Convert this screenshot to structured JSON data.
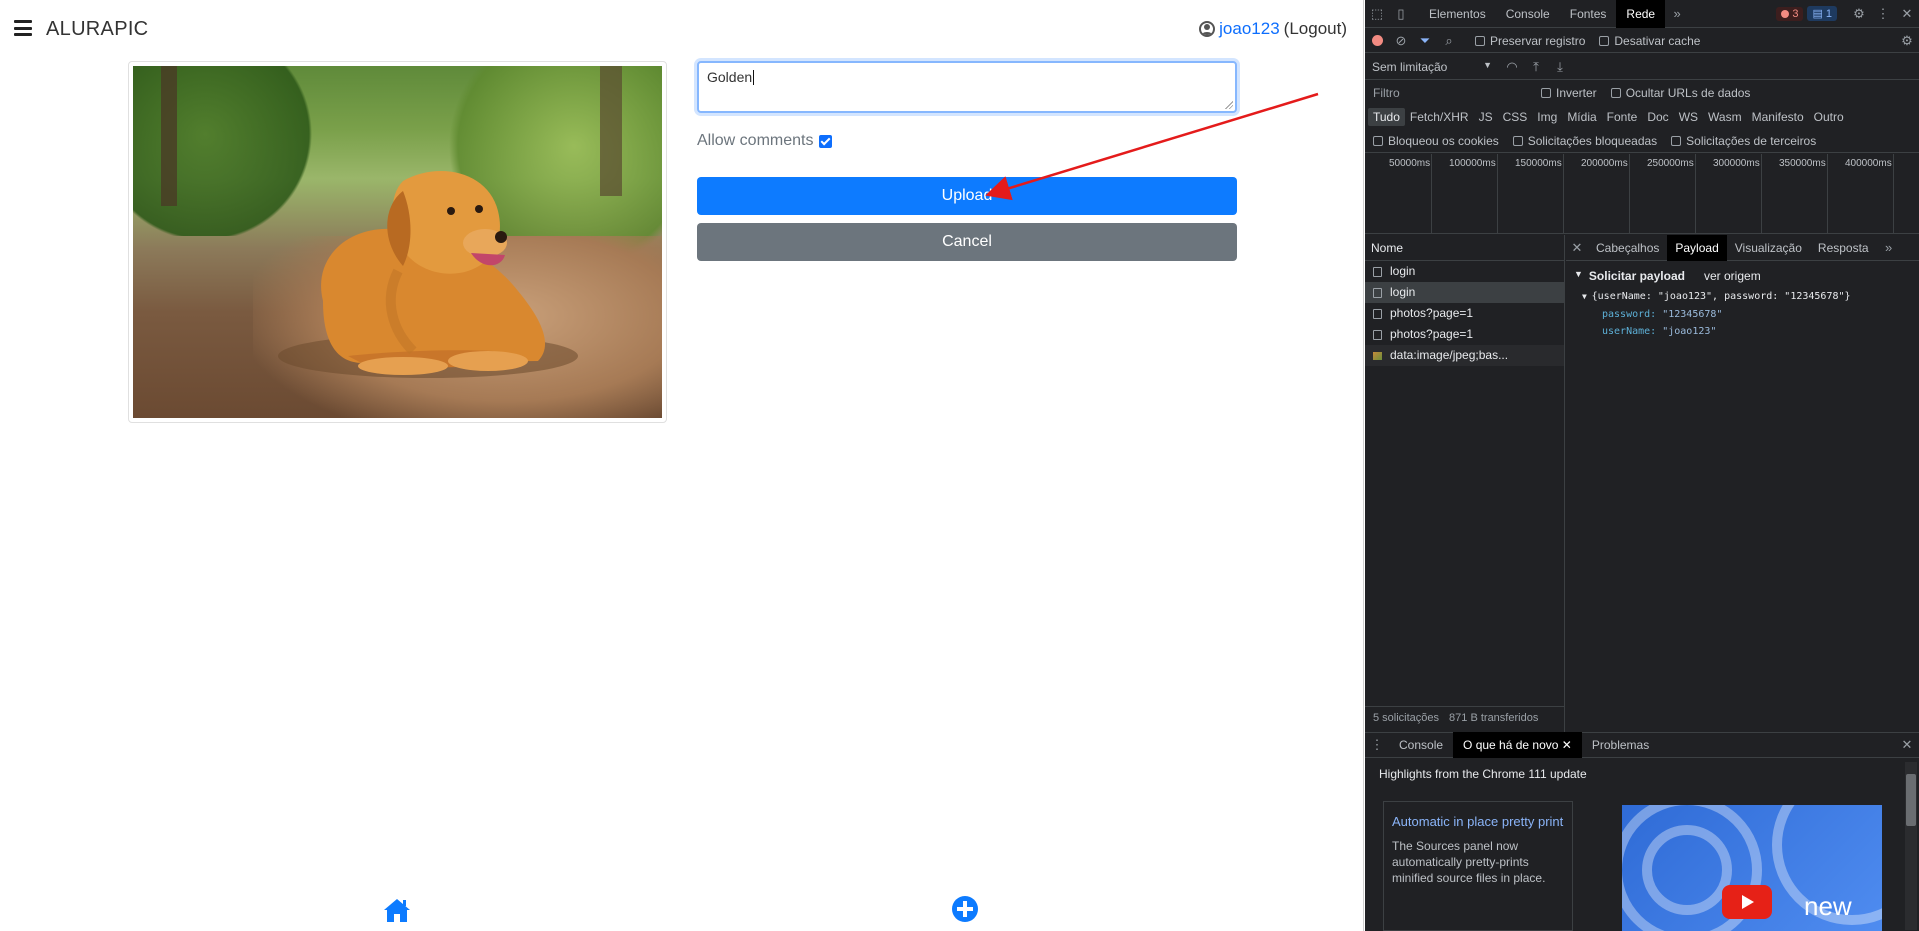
{
  "app": {
    "brand": "ALURAPIC",
    "user_name": "joao123",
    "logout_label": "(Logout)"
  },
  "form": {
    "caption_value": "Golden",
    "allow_comments_label": "Allow comments",
    "allow_comments_checked": true,
    "upload_label": "Upload",
    "cancel_label": "Cancel"
  },
  "colors": {
    "primary": "#0d7bff",
    "secondary": "#6c757d",
    "annotation_arrow": "#e41b1b"
  },
  "devtools": {
    "main_tabs": [
      "Elementos",
      "Console",
      "Fontes",
      "Rede"
    ],
    "active_main_tab": "Rede",
    "error_count": "3",
    "message_count": "1",
    "preserve_log_label": "Preservar registro",
    "disable_cache_label": "Desativar cache",
    "throttling_label": "Sem limitação",
    "filter_placeholder": "Filtro",
    "invert_label": "Inverter",
    "hide_data_urls_label": "Ocultar URLs de dados",
    "type_filters": [
      "Tudo",
      "Fetch/XHR",
      "JS",
      "CSS",
      "Img",
      "Mídia",
      "Fonte",
      "Doc",
      "WS",
      "Wasm",
      "Manifesto",
      "Outro"
    ],
    "blocked_cookies_label": "Bloqueou os cookies",
    "blocked_requests_label": "Solicitações bloqueadas",
    "third_party_label": "Solicitações de terceiros",
    "timeline_ticks": [
      "50000ms",
      "100000ms",
      "150000ms",
      "200000ms",
      "250000ms",
      "300000ms",
      "350000ms",
      "400000ms"
    ],
    "name_header": "Nome",
    "requests": [
      "login",
      "login",
      "photos?page=1",
      "photos?page=1",
      "data:image/jpeg;bas..."
    ],
    "detail_tabs": [
      "Cabeçalhos",
      "Payload",
      "Visualização",
      "Resposta"
    ],
    "active_detail_tab": "Payload",
    "payload_title": "Solicitar payload",
    "view_source_label": "ver origem",
    "payload_summary": "{userName: \"joao123\", password: \"12345678\"}",
    "payload_password_key": "password:",
    "payload_password_value": "\"12345678\"",
    "payload_username_key": "userName:",
    "payload_username_value": "\"joao123\"",
    "status_requests": "5 solicitações",
    "status_transferred": "871 B transferidos",
    "drawer_tabs": [
      "Console",
      "O que há de novo",
      "Problemas"
    ],
    "active_drawer_tab": "O que há de novo",
    "highlights_title": "Highlights from the Chrome 111 update",
    "news_link": "Automatic in place pretty print",
    "news_desc": "The Sources panel now automatically pretty-prints minified source files in place.",
    "thumb_text": "new"
  }
}
